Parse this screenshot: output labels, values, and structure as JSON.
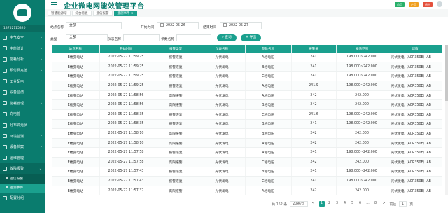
{
  "app": {
    "title": "企业微电网能效管理平台"
  },
  "top_actions": [
    {
      "label": "首页",
      "color": "#28b06a"
    },
    {
      "label": "产品",
      "color": "#f0a020"
    },
    {
      "label": "退出",
      "color": "#e4503c"
    }
  ],
  "sidebar": {
    "account": "13752115320",
    "items": [
      {
        "label": "电气安全"
      },
      {
        "label": "电能统计"
      },
      {
        "label": "能耗分析"
      },
      {
        "label": "预付费充值"
      },
      {
        "label": "工业配电"
      },
      {
        "label": "设备监测"
      },
      {
        "label": "能耗管理"
      },
      {
        "label": "充电桩"
      },
      {
        "label": "分布式光伏"
      },
      {
        "label": "环境监测"
      },
      {
        "label": "设备档案"
      },
      {
        "label": "运维管理"
      },
      {
        "label": "故障报警"
      }
    ],
    "sub_items": [
      {
        "label": "遥信报警"
      },
      {
        "label": "遥测事件"
      }
    ],
    "last_item": {
      "label": "配置分组"
    }
  },
  "tabs": [
    {
      "label": "智慧能源馆"
    },
    {
      "label": "综合看板"
    },
    {
      "label": "遥信报警"
    },
    {
      "label": "遥测事件 ×"
    }
  ],
  "filter": {
    "station_label": "站点名称",
    "station_value": "全部",
    "start_label": "开始时间",
    "start_value": "2022-05-26",
    "end_label": "结束时间",
    "end_value": "2022-05-27",
    "type_label": "类型",
    "type_value": "全部",
    "device_label": "仪表名称",
    "device_placeholder": "",
    "param_label": "参数名称",
    "param_placeholder": "",
    "query_button": "查询",
    "export_button": "导出"
  },
  "table": {
    "columns": [
      "站点名称",
      "开始时间",
      "报警类型",
      "仪表名称",
      "参数名称",
      "报警值",
      "阈值范围",
      "详情"
    ],
    "rows": [
      [
        "E楼变电站",
        "2022-05-27 11:59:25",
        "报警恢复",
        "光伏发电",
        "A相电压",
        "241",
        "198.000~242.000",
        "光伏发电（ACR350E）AB"
      ],
      [
        "E楼变电站",
        "2022-05-27 11:59:25",
        "报警恢复",
        "光伏发电",
        "B相电压",
        "241",
        "198.000~242.000",
        "光伏发电（ACR350E）AB"
      ],
      [
        "E楼变电站",
        "2022-05-27 11:59:25",
        "报警恢复",
        "光伏发电",
        "C相电压",
        "241",
        "198.000~242.000",
        "光伏发电（ACR350E）AB"
      ],
      [
        "E楼变电站",
        "2022-05-27 11:59:25",
        "报警恢复",
        "光伏发电",
        "A相电压",
        "241.9",
        "198.000~242.000",
        "光伏发电（ACR350E）AB"
      ],
      [
        "E楼变电站",
        "2022-05-27 11:58:56",
        "高限报警",
        "光伏发电",
        "A相电压",
        "242",
        "242.000",
        "光伏发电（ACR350E）AB"
      ],
      [
        "E楼变电站",
        "2022-05-27 11:58:56",
        "高限报警",
        "光伏发电",
        "B相电压",
        "242",
        "242.000",
        "光伏发电（ACR350E）AB"
      ],
      [
        "E楼变电站",
        "2022-05-27 11:58:35",
        "报警恢复",
        "光伏发电",
        "C相电压",
        "241.6",
        "198.000~242.000",
        "光伏发电（ACR350E）AB"
      ],
      [
        "E楼变电站",
        "2022-05-27 11:58:35",
        "报警恢复",
        "光伏发电",
        "B相电压",
        "241",
        "198.000~242.000",
        "光伏发电（ACR350E）AB"
      ],
      [
        "E楼变电站",
        "2022-05-27 11:58:10",
        "高限报警",
        "光伏发电",
        "B相电压",
        "242",
        "242.000",
        "光伏发电（ACR350E）AB"
      ],
      [
        "E楼变电站",
        "2022-05-27 11:58:10",
        "高限报警",
        "光伏发电",
        "A相电压",
        "242",
        "242.000",
        "光伏发电（ACR350E）AB"
      ],
      [
        "E楼变电站",
        "2022-05-27 11:57:58",
        "报警恢复",
        "光伏发电",
        "A相电压",
        "241",
        "198.000~242.000",
        "光伏发电（ACR350E）AB"
      ],
      [
        "E楼变电站",
        "2022-05-27 11:57:58",
        "高限报警",
        "光伏发电",
        "C相电压",
        "242",
        "242.000",
        "光伏发电（ACR350E）AB"
      ],
      [
        "E楼变电站",
        "2022-05-27 11:57:43",
        "报警恢复",
        "光伏发电",
        "B相电压",
        "241",
        "198.000~242.000",
        "光伏发电（ACR350E）AB"
      ],
      [
        "E楼变电站",
        "2022-05-27 11:57:43",
        "报警恢复",
        "光伏发电",
        "C相电压",
        "241",
        "198.000~242.000",
        "光伏发电（ACR350E）AB"
      ],
      [
        "E楼变电站",
        "2022-05-27 11:57:37",
        "高限报警",
        "光伏发电",
        "A相电压",
        "242",
        "242.000",
        "光伏发电（ACR350E）AB"
      ],
      [
        "E楼变电站",
        "2022-05-27 11:57:26",
        "报警恢复",
        "光伏发电",
        "A相电压",
        "241",
        "198.000~242.000",
        "光伏发电（ACR350E）AB"
      ]
    ]
  },
  "pager": {
    "total": "共 152 条",
    "page_size": "20条/页",
    "prev": "<",
    "pages": [
      "1",
      "2",
      "3",
      "4",
      "5",
      "6",
      "...",
      "8"
    ],
    "next": ">",
    "goto_label": "前往",
    "goto_value": "1",
    "page_suffix": "页"
  }
}
